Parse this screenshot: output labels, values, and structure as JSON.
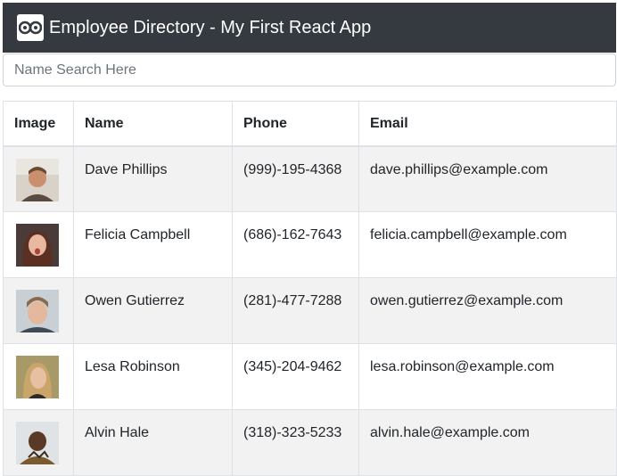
{
  "navbar": {
    "logo_icon": "react-logo-icon",
    "title": "Employee Directory - My First React App"
  },
  "search": {
    "placeholder": "Name Search Here",
    "value": ""
  },
  "table": {
    "headers": [
      "Image",
      "Name",
      "Phone",
      "Email"
    ],
    "rows": [
      {
        "image": "avatar-photo",
        "name": "Dave Phillips",
        "phone": "(999)-195-4368",
        "email": "dave.phillips@example.com"
      },
      {
        "image": "avatar-photo",
        "name": "Felicia Campbell",
        "phone": "(686)-162-7643",
        "email": "felicia.campbell@example.com"
      },
      {
        "image": "avatar-photo",
        "name": "Owen Gutierrez",
        "phone": "(281)-477-7288",
        "email": "owen.gutierrez@example.com"
      },
      {
        "image": "avatar-photo",
        "name": "Lesa Robinson",
        "phone": "(345)-204-9462",
        "email": "lesa.robinson@example.com"
      },
      {
        "image": "avatar-photo",
        "name": "Alvin Hale",
        "phone": "(318)-323-5233",
        "email": "alvin.hale@example.com"
      }
    ]
  },
  "colors": {
    "navbar_bg": "#343a40",
    "stripe_bg": "#f2f2f2",
    "border": "#dee2e6"
  }
}
